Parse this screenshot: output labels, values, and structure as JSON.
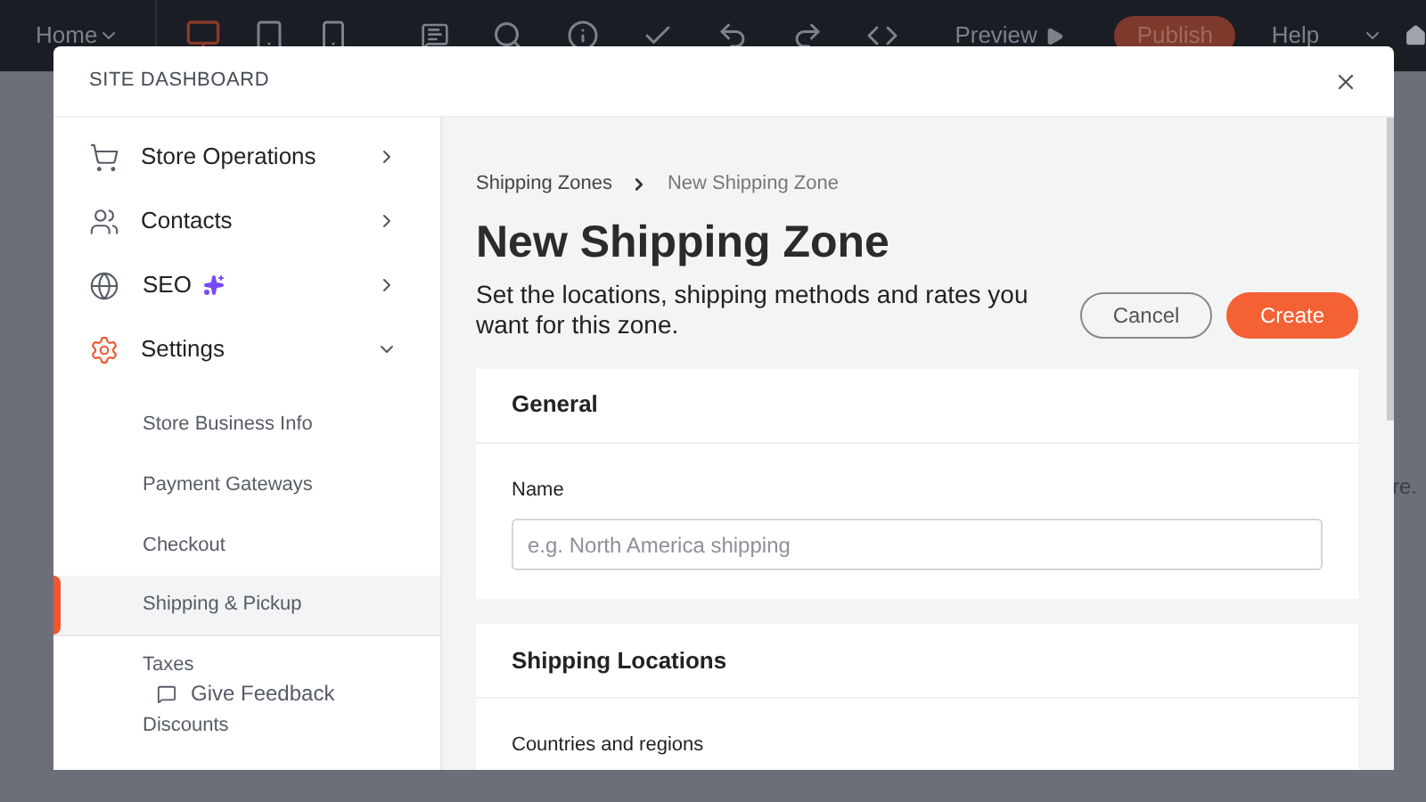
{
  "toolbar": {
    "page_menu": "Home",
    "preview": "Preview",
    "publish": "Publish",
    "help": "Help"
  },
  "background_text": "re.",
  "dashboard": {
    "title": "SITE DASHBOARD"
  },
  "sidebar": {
    "items": [
      {
        "kind": "cart",
        "label": "Store Operations",
        "selected": false,
        "expanded": false,
        "sparkle": false
      },
      {
        "kind": "people",
        "label": "Contacts",
        "selected": false,
        "expanded": false,
        "sparkle": false
      },
      {
        "kind": "globe",
        "label": "SEO",
        "selected": false,
        "expanded": false,
        "sparkle": true
      },
      {
        "kind": "gear",
        "label": "Settings",
        "selected": true,
        "expanded": true,
        "sparkle": false,
        "children": [
          {
            "label": "Store Business Info",
            "selected": false
          },
          {
            "label": "Payment Gateways",
            "selected": false
          },
          {
            "label": "Checkout",
            "selected": false
          },
          {
            "label": "Shipping & Pickup",
            "selected": true
          },
          {
            "label": "Taxes",
            "selected": false
          },
          {
            "label": "Discounts",
            "selected": false
          }
        ]
      }
    ],
    "feedback_button": "Give Feedback"
  },
  "main": {
    "breadcrumb": [
      "Shipping Zones",
      "New Shipping Zone"
    ],
    "title": "New Shipping Zone",
    "description": "Set the locations, shipping methods and rates you want for this zone.",
    "buttons": {
      "cancel": "Cancel",
      "create": "Create"
    },
    "sections": [
      {
        "title": "General",
        "fields": [
          {
            "label": "Name",
            "placeholder": "e.g. North America shipping"
          }
        ]
      },
      {
        "title": "Shipping Locations",
        "fields": [
          {
            "label": "Countries and regions"
          }
        ]
      }
    ]
  }
}
